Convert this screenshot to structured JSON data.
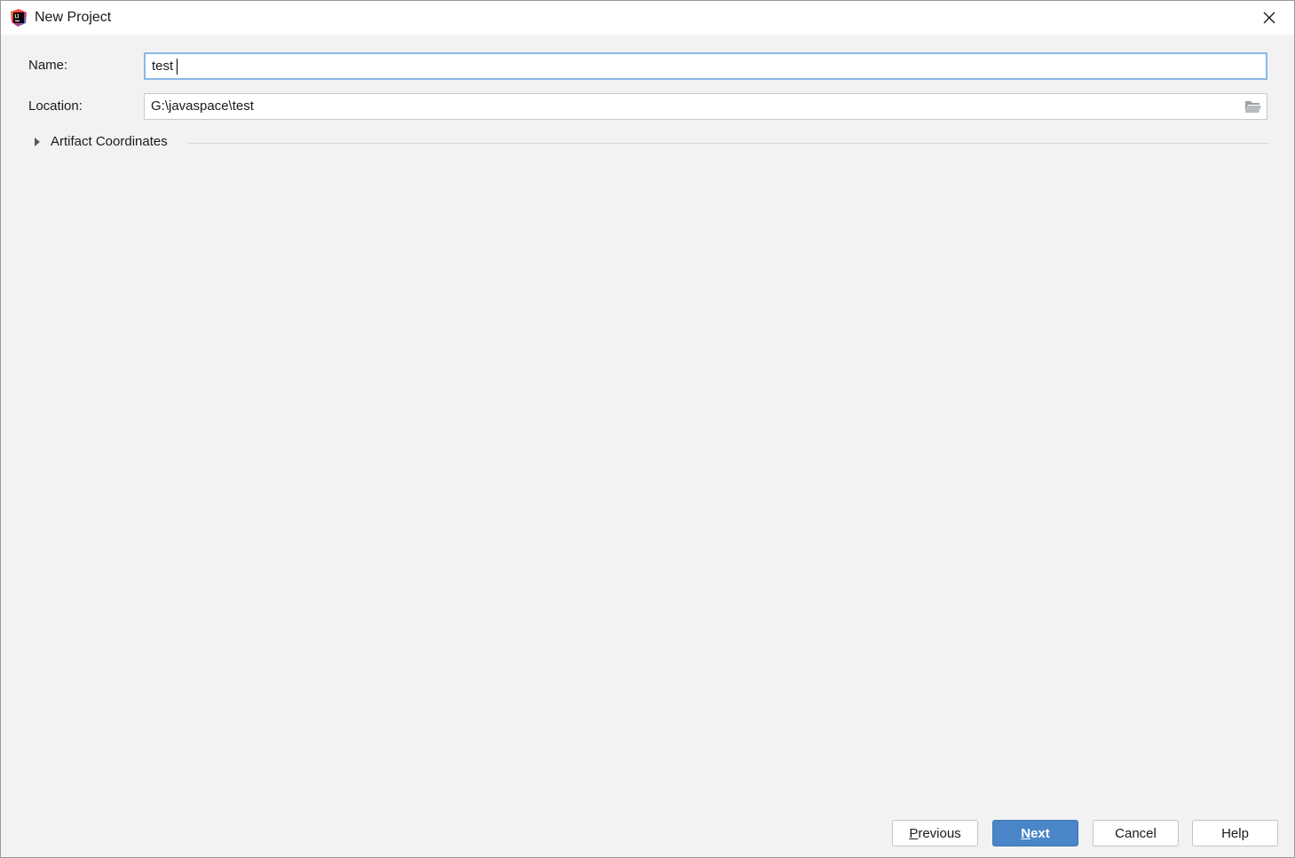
{
  "window": {
    "title": "New Project",
    "app_icon": "intellij-idea-icon",
    "close_icon": "close-icon"
  },
  "form": {
    "name_label": "Name:",
    "name_value": "test",
    "location_label": "Location:",
    "location_value": "G:\\javaspace\\test",
    "browse_icon": "folder-open-icon"
  },
  "section": {
    "label": "Artifact Coordinates",
    "expanded": false,
    "arrow_icon": "triangle-right-icon"
  },
  "buttons": {
    "previous_mnemonic": "P",
    "previous_rest": "revious",
    "next_mnemonic": "N",
    "next_rest": "ext",
    "cancel": "Cancel",
    "help": "Help"
  },
  "colors": {
    "primary_button": "#4a86c7",
    "focus_border": "#8ab8ea",
    "background": "#f2f2f2"
  }
}
